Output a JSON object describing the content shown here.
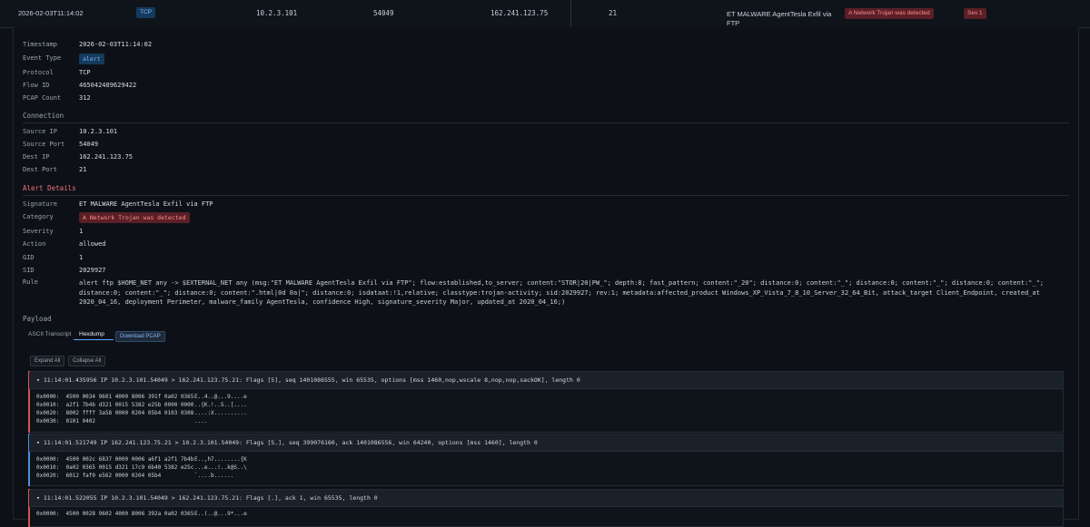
{
  "summary": {
    "timestamp": "2026-02-03T11:14:02",
    "protocol": "TCP",
    "src_ip": "10.2.3.101",
    "src_port": "54049",
    "dest_ip": "162.241.123.75",
    "dest_port": "21",
    "signature": "ET MALWARE AgentTesla Exfil via FTP",
    "category": "A Network Trojan was detected",
    "severity": "Sev 1"
  },
  "details": {
    "timestamp_label": "Timestamp",
    "timestamp": "2026-02-03T11:14:02",
    "event_type_label": "Event Type",
    "event_type": "alert",
    "protocol_label": "Protocol",
    "protocol": "TCP",
    "flow_id_label": "Flow ID",
    "flow_id": "465042489629422",
    "pcap_count_label": "PCAP Count",
    "pcap_count": "312"
  },
  "connection": {
    "title": "Connection",
    "src_ip_label": "Source IP",
    "src_ip": "10.2.3.101",
    "src_port_label": "Source Port",
    "src_port": "54049",
    "dest_ip_label": "Dest IP",
    "dest_ip": "162.241.123.75",
    "dest_port_label": "Dest Port",
    "dest_port": "21"
  },
  "alert": {
    "title": "Alert Details",
    "signature_label": "Signature",
    "signature": "ET MALWARE AgentTesla Exfil via FTP",
    "category_label": "Category",
    "category": "A Network Trojan was detected",
    "severity_label": "Severity",
    "severity": "1",
    "action_label": "Action",
    "action": "allowed",
    "gid_label": "GID",
    "gid": "1",
    "sid_label": "SID",
    "sid": "2029927",
    "rule_label": "Rule",
    "rule": "alert ftp $HOME_NET any -> $EXTERNAL_NET any (msg:\"ET MALWARE AgentTesla Exfil via FTP\"; flow:established,to_server; content:\"STOR|20|PW_\"; depth:8; fast_pattern; content:\"_20\"; distance:0; content:\"_\"; distance:0; content:\"_\"; distance:0; content:\"_\"; distance:0; content:\"_\"; distance:0; content:\".html|0d 0a|\"; distance:0; isdataat:!1,relative; classtype:trojan-activity; sid:2029927; rev:1; metadata:affected_product Windows_XP_Vista_7_8_10_Server_32_64_Bit, attack_target Client_Endpoint, created_at 2020_04_16, deployment Perimeter, malware_family AgentTesla, confidence High, signature_severity Major, updated_at 2020_04_16;)"
  },
  "payload": {
    "title": "Payload",
    "tab_ascii": "ASCII Transcript",
    "tab_hex": "Hexdump",
    "download": "Download PCAP",
    "expand_all": "Expand All",
    "collapse_all": "Collapse All"
  },
  "packets": [
    {
      "header": "▾ 11:14:01.435956 IP 10.2.3.101.54049 > 162.241.123.75.21: Flags [S], seq 1401086555, win 65535, options [mss 1460,nop,wscale 8,nop,nop,sackOK], length 0",
      "hex": [
        "0x0000:  4500 0034 9601 4000 8006 391f 0a02 0365",
        "0x0010:  a2f1 7b4b d321 0015 5382 e25b 0000 0000",
        "0x0020:  8002 ffff 3a58 0000 0204 05b4 0103 0308",
        "0x0030:  0101 0402"
      ],
      "ascii": [
        "E..4..@...9....e",
        "..{K.!..S..[....",
        "....:X..........",
        "...."
      ]
    },
    {
      "header": "▾ 11:14:01.521749 IP 162.241.123.75.21 > 10.2.3.101.54049: Flags [S.], seq 399076160, ack 1401086556, win 64240, options [mss 1460], length 0",
      "hex": [
        "0x0000:  4500 002c 6837 0000 0006 a6f1 a2f1 7b4b",
        "0x0010:  0a02 0365 0015 d321 17c9 6b40 5382 e25c",
        "0x0020:  6012 faf0 e562 0000 0204 05b4"
      ],
      "ascii": [
        "E..,h7........{K",
        "...e...!..k@S..\\",
        "`....b......"
      ]
    },
    {
      "header": "▾ 11:14:01.522055 IP 10.2.3.101.54049 > 162.241.123.75.21: Flags [.], ack 1, win 65535, length 0",
      "hex": [
        "0x0000:  4500 0028 9602 4000 8006 392a 0a02 0365"
      ],
      "ascii": [
        "E..(..@...9*...e"
      ]
    }
  ],
  "colors": {
    "bg": "#0d1117",
    "red_accent": "#d9534f",
    "blue_accent": "#4a90d9"
  }
}
